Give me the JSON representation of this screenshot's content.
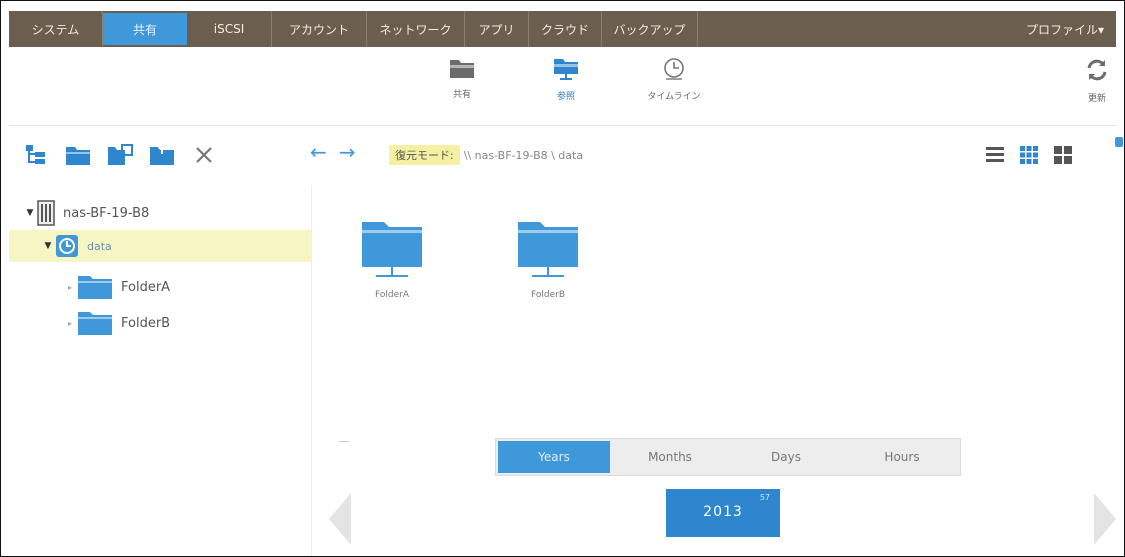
{
  "nav": {
    "tabs": [
      {
        "label": "システム"
      },
      {
        "label": "共有"
      },
      {
        "label": "iSCSI"
      },
      {
        "label": "アカウント"
      },
      {
        "label": "ネットワーク"
      },
      {
        "label": "アプリ"
      },
      {
        "label": "クラウド"
      },
      {
        "label": "バックアップ"
      }
    ],
    "active_tab": "共有",
    "profile_label": "プロファイル▾"
  },
  "toolbar": {
    "shares_label": "共有",
    "browse_label": "参照",
    "timeline_label": "タイムライン",
    "refresh_label": "更新",
    "active": "参照"
  },
  "breadcrumb": {
    "mode_label": "復元モード:",
    "path": "\\\\ nas-BF-19-B8 \\ data"
  },
  "tree": {
    "device": "nas-BF-19-B8",
    "volume": "data",
    "folders": [
      {
        "name": "FolderA"
      },
      {
        "name": "FolderB"
      }
    ]
  },
  "content": {
    "folders": [
      {
        "name": "FolderA"
      },
      {
        "name": "FolderB"
      }
    ]
  },
  "timeline": {
    "tabs": [
      {
        "label": "Years"
      },
      {
        "label": "Months"
      },
      {
        "label": "Days"
      },
      {
        "label": "Hours"
      }
    ],
    "active": "Years",
    "year": "2013",
    "snapshot_count": "57"
  },
  "colors": {
    "nav_bg": "#6b5e4e",
    "accent": "#3f98da",
    "selected_row": "#f8f5c5",
    "breadcrumb_mode_bg": "#f6f0a2",
    "folder_icon": "#3f98da"
  },
  "icons": {
    "toolbar": [
      "folder-icon",
      "browse-icon",
      "clock-icon",
      "refresh-icon"
    ],
    "left_actions": [
      "tree-icon",
      "new-folder-icon",
      "copy-folder-icon",
      "move-folder-icon",
      "delete-icon"
    ],
    "views": [
      "list-view-icon",
      "grid-view-icon",
      "tile-view-icon"
    ]
  }
}
